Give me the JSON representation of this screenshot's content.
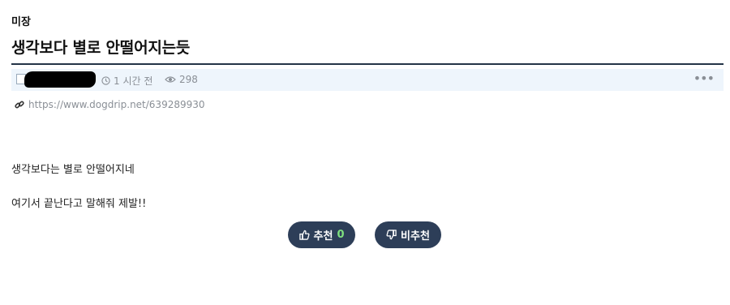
{
  "post": {
    "category": "미장",
    "title": "생각보다 별로 안떨어지는듯",
    "meta": {
      "time": "1 시간 전",
      "views": "298",
      "more_label": "•••"
    },
    "source_url": "https://www.dogdrip.net/639289930",
    "body_lines": [
      "생각보다는 별로 안떨어지네",
      "여기서 끝난다고 말해줘 제발!!"
    ]
  },
  "votes": {
    "up_label": "추천",
    "up_count": "0",
    "down_label": "비추천"
  },
  "icons": {
    "clock": "clock-icon",
    "eye": "eye-icon",
    "link": "link-icon",
    "thumbs_up": "thumbs-up-icon",
    "thumbs_down": "thumbs-down-icon",
    "more": "more-icon"
  },
  "colors": {
    "title_rule": "#243447",
    "meta_bar_bg": "#eef5fc",
    "button_bg": "#2d3e58",
    "vote_count": "#7fe07f"
  }
}
